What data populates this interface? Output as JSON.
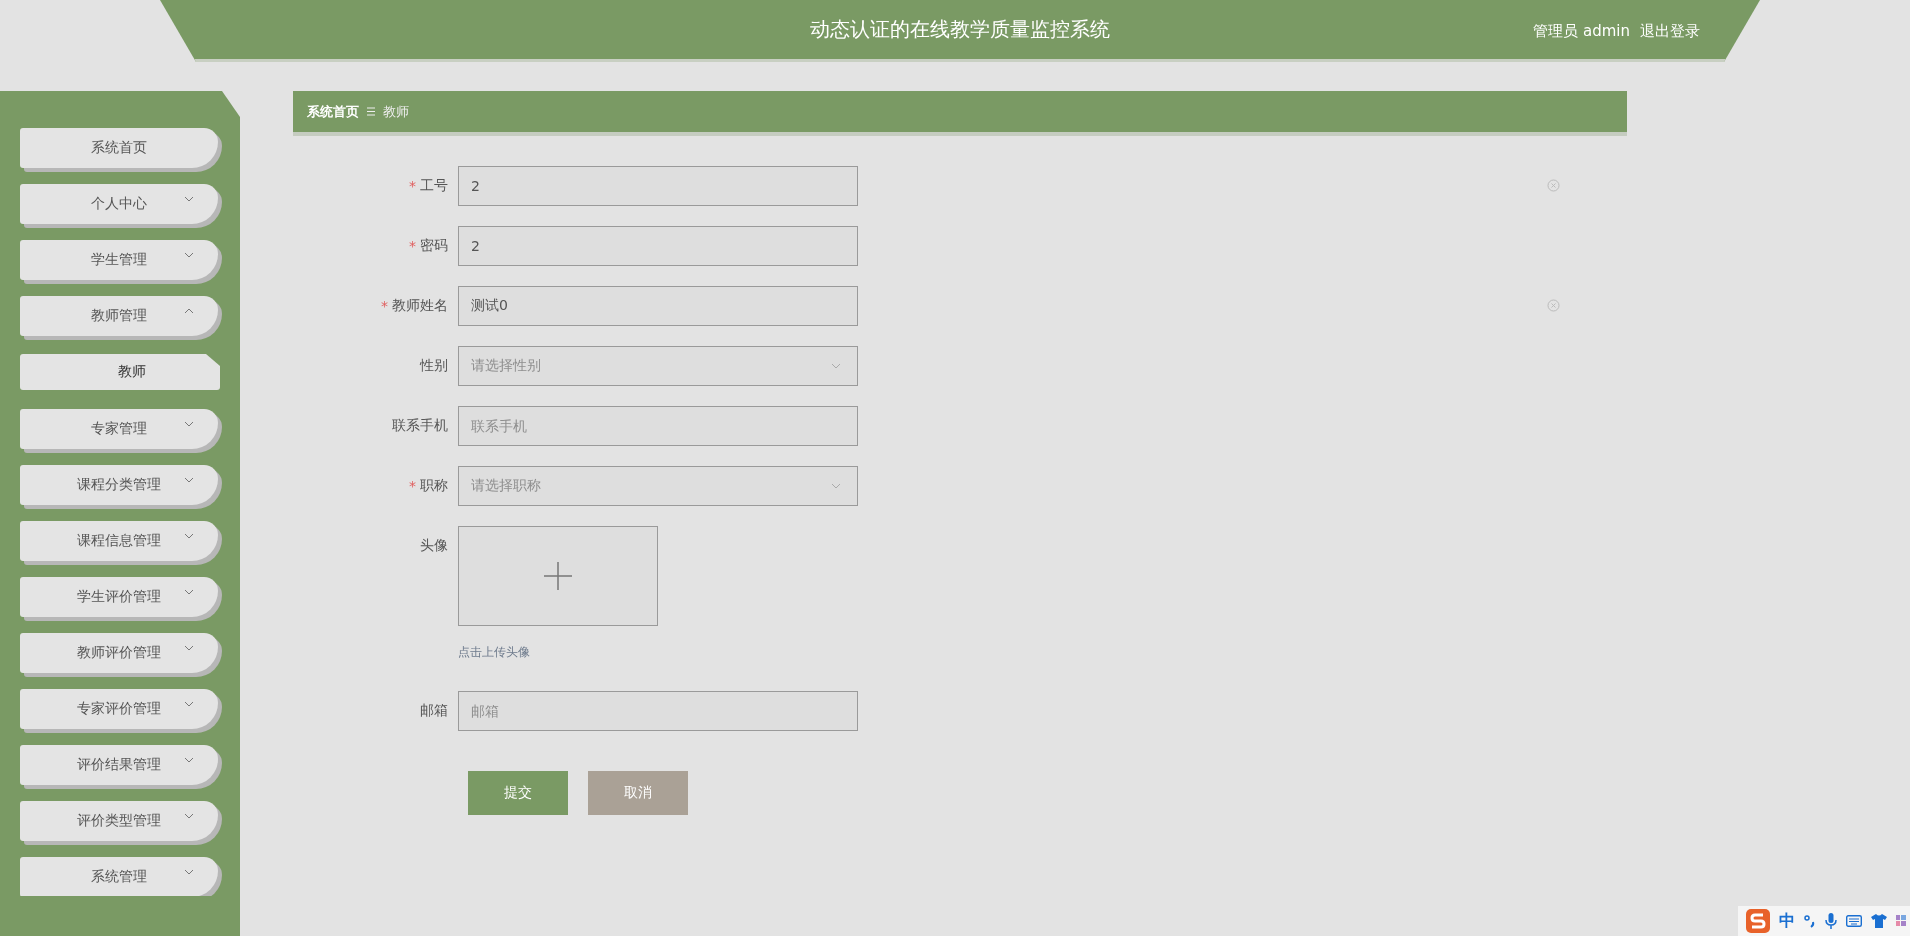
{
  "header": {
    "title": "动态认证的在线教学质量监控系统",
    "user": "管理员 admin",
    "logout": "退出登录"
  },
  "sidebar": {
    "items": [
      {
        "label": "系统首页",
        "kind": "link"
      },
      {
        "label": "个人中心",
        "kind": "group",
        "expanded": false
      },
      {
        "label": "学生管理",
        "kind": "group",
        "expanded": false
      },
      {
        "label": "教师管理",
        "kind": "group",
        "expanded": true,
        "children": [
          {
            "label": "教师",
            "selected": true
          }
        ]
      },
      {
        "label": "专家管理",
        "kind": "group",
        "expanded": false
      },
      {
        "label": "课程分类管理",
        "kind": "group",
        "expanded": false
      },
      {
        "label": "课程信息管理",
        "kind": "group",
        "expanded": false
      },
      {
        "label": "学生评价管理",
        "kind": "group",
        "expanded": false
      },
      {
        "label": "教师评价管理",
        "kind": "group",
        "expanded": false
      },
      {
        "label": "专家评价管理",
        "kind": "group",
        "expanded": false
      },
      {
        "label": "评价结果管理",
        "kind": "group",
        "expanded": false
      },
      {
        "label": "评价类型管理",
        "kind": "group",
        "expanded": false
      },
      {
        "label": "系统管理",
        "kind": "group",
        "expanded": false
      }
    ]
  },
  "breadcrumb": [
    "系统首页",
    "教师"
  ],
  "form": {
    "fields": [
      {
        "required_mark": "*",
        "label": "工号",
        "kind": "input",
        "value": "2",
        "clearable": true
      },
      {
        "required_mark": "*",
        "label": "密码",
        "kind": "input",
        "value": "2"
      },
      {
        "required_mark": "*",
        "label": "教师姓名",
        "kind": "input",
        "value": "测试0",
        "clearable": true
      },
      {
        "label": "性别",
        "kind": "select",
        "placeholder": "请选择性别"
      },
      {
        "label": "联系手机",
        "kind": "input",
        "placeholder": "联系手机"
      },
      {
        "required_mark": "*",
        "label": "职称",
        "kind": "select",
        "placeholder": "请选择职称"
      },
      {
        "label": "头像",
        "kind": "upload",
        "hint": "点击上传头像"
      },
      {
        "label": "邮箱",
        "kind": "input",
        "placeholder": "邮箱"
      }
    ],
    "buttons": [
      {
        "label": "提交",
        "kind": "primary"
      },
      {
        "label": "取消",
        "kind": "cancel"
      }
    ]
  },
  "ime": {
    "mode": "中"
  }
}
